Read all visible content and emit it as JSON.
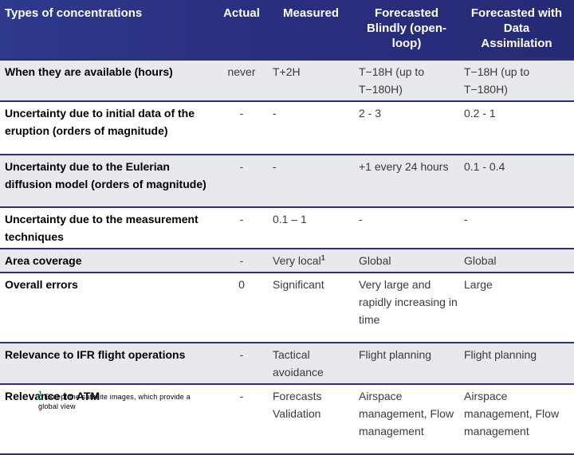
{
  "table": {
    "columns": [
      {
        "key": "label",
        "label": "Types of concentrations"
      },
      {
        "key": "actual",
        "label": "Actual"
      },
      {
        "key": "measured",
        "label": "Measured"
      },
      {
        "key": "blind",
        "label": "Forecasted Blindly (open-loop)"
      },
      {
        "key": "da",
        "label": "Forecasted with Data Assimilation"
      }
    ],
    "header": {
      "col1": "Types of concentrations",
      "col2": "Actual",
      "col3": "Measured",
      "col4_line1": "Forecasted",
      "col4_line2": "Blindly (open-",
      "col4_line3": "loop)",
      "col5_line1": "Forecasted with",
      "col5_line2": "Data",
      "col5_line3": "Assimilation"
    },
    "rows": [
      {
        "label": "When they are available (hours)",
        "actual": "never",
        "measured": "T+2H",
        "blind": "T−18H (up to T−180H)",
        "da": "T−18H (up to T−180H)"
      },
      {
        "label": "Uncertainty due to initial data of the eruption (orders of magnitude)",
        "actual": "-",
        "measured": "-",
        "blind": "2 - 3",
        "da": "0.2 - 1"
      },
      {
        "label": "Uncertainty due to the Eulerian diffusion model (orders of magnitude)",
        "actual": "-",
        "measured": "-",
        "blind": "+1 every 24 hours",
        "da": "0.1 - 0.4"
      },
      {
        "label": "Uncertainty due to the measurement techniques",
        "actual": "-",
        "measured": "0.1 – 1",
        "blind": "-",
        "da": "-"
      },
      {
        "label": "Area coverage",
        "actual": "-",
        "measured": "Very local",
        "measured_sup": "1",
        "blind": "Global",
        "da": "Global"
      },
      {
        "label": "Overall errors",
        "actual": "0",
        "measured": "Significant",
        "blind": "Very large and rapidly increasing in time",
        "da": "Large"
      },
      {
        "label": "Relevance to IFR flight operations",
        "actual": "-",
        "measured": "Tactical avoidance",
        "blind": "Flight planning",
        "da": "Flight planning"
      },
      {
        "label": "Relevance to ATM",
        "actual": "-",
        "measured": "Forecasts Validation",
        "blind": "Airspace management, Flow management",
        "da": "Airspace management, Flow management"
      }
    ]
  },
  "footnote": {
    "marker": "1",
    "text": "Except the satellite images, which provide a global view"
  },
  "colors": {
    "header_bg": "#2b2f80",
    "header_text": "#ffffff",
    "row_shade": "#e8e8ef",
    "row_plain": "#ffffff",
    "rule": "#2b2f80",
    "label_text": "#000000",
    "value_text": "#3a3a3a",
    "footnote_marker": "#177d77"
  }
}
